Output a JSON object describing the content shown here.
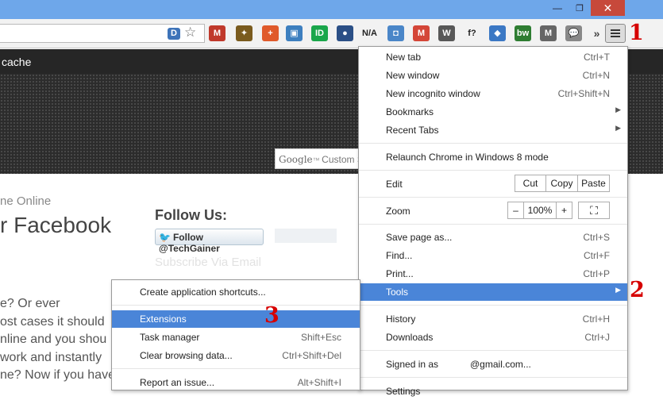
{
  "window": {
    "minimize_glyph": "—",
    "maximize_glyph": "❐",
    "close_glyph": "✕"
  },
  "omnibox": {
    "extension_letter": "D",
    "star_icon": "star-icon"
  },
  "extensions": [
    {
      "name": "gmail-icon",
      "text": "M",
      "color": "#c0392b"
    },
    {
      "name": "sprite-icon",
      "text": "✦",
      "color": "#7a5b1e"
    },
    {
      "name": "plus-icon",
      "text": "+",
      "color": "#e05a2b"
    },
    {
      "name": "image-icon",
      "text": "▣",
      "color": "#3d7fbf"
    },
    {
      "name": "id-icon",
      "text": "ID",
      "color": "#1aa64b"
    },
    {
      "name": "owl-icon",
      "text": "●",
      "color": "#2b4f86"
    },
    {
      "name": "na-icon",
      "text": "N/A",
      "color": "#ffffff"
    },
    {
      "name": "screenshot-icon",
      "text": "◘",
      "color": "#4a86c8"
    },
    {
      "name": "gmail-check-icon",
      "text": "M",
      "color": "#d44638"
    },
    {
      "name": "wordpress-icon",
      "text": "W",
      "color": "#585858"
    },
    {
      "name": "fx-icon",
      "text": "f?",
      "color": "#ffffff"
    },
    {
      "name": "network-icon",
      "text": "◆",
      "color": "#3b78c4"
    },
    {
      "name": "bw-icon",
      "text": "bw",
      "color": "#2e7d32"
    },
    {
      "name": "mail-check-icon",
      "text": "M",
      "color": "#666666"
    },
    {
      "name": "chat-icon",
      "text": "💬",
      "color": "#888888"
    }
  ],
  "overflow_chevron": "»",
  "annotations": {
    "one": "1",
    "two": "2",
    "three": "3"
  },
  "page": {
    "banner_text": "cache",
    "google_logo": "Google",
    "search_placeholder": "Custom Sea",
    "partial_subtitle": "ne Online",
    "partial_heading": "r Facebook",
    "follow_heading": "Follow Us:",
    "twitter_button": "Follow @TechGainer",
    "faded_text": "Subscribe Via Email",
    "body_lines": [
      "e? Or ever",
      "ost cases it should",
      "nline and you shou",
      "work and instantly",
      "ne? Now if you have"
    ]
  },
  "menu": {
    "new_tab": {
      "label": "New tab",
      "shortcut": "Ctrl+T"
    },
    "new_window": {
      "label": "New window",
      "shortcut": "Ctrl+N"
    },
    "incognito": {
      "label": "New incognito window",
      "shortcut": "Ctrl+Shift+N"
    },
    "bookmarks": {
      "label": "Bookmarks"
    },
    "recent_tabs": {
      "label": "Recent Tabs"
    },
    "relaunch": {
      "label": "Relaunch Chrome in Windows 8 mode"
    },
    "edit": {
      "label": "Edit",
      "cut": "Cut",
      "copy": "Copy",
      "paste": "Paste"
    },
    "zoom": {
      "label": "Zoom",
      "minus": "–",
      "value": "100%",
      "plus": "+",
      "fullscreen": "⛶"
    },
    "save_page": {
      "label": "Save page as...",
      "shortcut": "Ctrl+S"
    },
    "find": {
      "label": "Find...",
      "shortcut": "Ctrl+F"
    },
    "print": {
      "label": "Print...",
      "shortcut": "Ctrl+P"
    },
    "tools": {
      "label": "Tools"
    },
    "history": {
      "label": "History",
      "shortcut": "Ctrl+H"
    },
    "downloads": {
      "label": "Downloads",
      "shortcut": "Ctrl+J"
    },
    "signed_in": {
      "label": "Signed in as",
      "email": "@gmail.com..."
    },
    "settings": {
      "label": "Settings"
    }
  },
  "tools_submenu": {
    "app_shortcuts": {
      "label": "Create application shortcuts..."
    },
    "extensions": {
      "label": "Extensions"
    },
    "task_manager": {
      "label": "Task manager",
      "shortcut": "Shift+Esc"
    },
    "clear_data": {
      "label": "Clear browsing data...",
      "shortcut": "Ctrl+Shift+Del"
    },
    "report_issue": {
      "label": "Report an issue...",
      "shortcut": "Alt+Shift+I"
    }
  }
}
